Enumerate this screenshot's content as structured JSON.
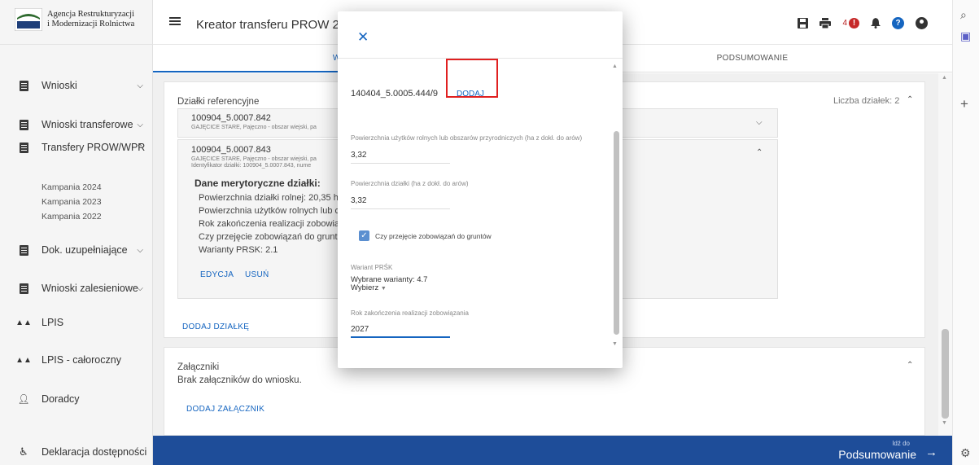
{
  "logo": {
    "line1": "Agencja Restrukturyzacji",
    "line2": "i Modernizacji Rolnictwa"
  },
  "sidebar": {
    "items": [
      {
        "label": "Wnioski"
      },
      {
        "label": "Wnioski transferowe"
      },
      {
        "label": "Transfery PROW/WPR"
      },
      {
        "label": "Dok. uzupełniające"
      },
      {
        "label": "Wnioski zalesieniowe"
      },
      {
        "label": "LPIS"
      },
      {
        "label": "LPIS - całoroczny"
      },
      {
        "label": "Doradcy"
      },
      {
        "label": "Deklaracja dostępności"
      }
    ],
    "subitems": [
      "Kampania 2024",
      "Kampania 2023",
      "Kampania 2022"
    ]
  },
  "header": {
    "title": "Kreator transferu PROW 2",
    "notification_count": "4"
  },
  "tabs": [
    "WNIOSEK",
    "PODSUMOWANIE"
  ],
  "main": {
    "parcels_title": "Działki referencyjne",
    "parcels_count": "Liczba działek: 2",
    "parcel1": {
      "id": "100904_5.0007.842",
      "sub": "GAJĘCICE STARE, Pajęczno - obszar wiejski, pa"
    },
    "parcel2": {
      "id": "100904_5.0007.843",
      "sub1": "GAJĘCICE STARE, Pajęczno - obszar wiejski, pa",
      "sub2": "Identyfikator działki: 100904_5.0007.843, nume",
      "merit_title": "Dane merytoryczne działki:",
      "lines": [
        "Powierzchnia działki rolnej: 20,35 ha",
        "Powierzchnia użytków rolnych lub ob",
        "Rok zakończenia realizacji zobowiąz",
        "Czy przejęcie zobowiązań do gruntów",
        "Warianty PRSK: 2.1"
      ],
      "edit": "EDYCJA",
      "delete": "USUŃ"
    },
    "add_parcel": "DODAJ DZIAŁKĘ",
    "attachments_title": "Załączniki",
    "attachments_empty": "Brak załączników do wniosku.",
    "add_attachment": "DODAJ ZAŁĄCZNIK"
  },
  "bottom": {
    "go_to": "Idź do",
    "target": "Podsumowanie"
  },
  "modal": {
    "parcel_id": "140404_5.0005.444/9",
    "add_label": "DODAJ",
    "field1_label": "Powierzchnia użytków rolnych lub obszarów przyrodniczych (ha z dokł. do arów)",
    "field1_value": "3,32",
    "field2_label": "Powierzchnia działki (ha z dokł. do arów)",
    "field2_value": "3,32",
    "checkbox_label": "Czy przejęcie zobowiązań do gruntów",
    "variant_label": "Wariant PRŚK",
    "variant_selected": "Wybrane warianty: 4.7",
    "variant_select": "Wybierz",
    "year_label": "Rok zakończenia realizacji zobowiązania",
    "year_value": "2027"
  },
  "colors": {
    "accent": "#1565c0",
    "bottom_bar": "#1e4d99",
    "highlight": "#e02020"
  }
}
